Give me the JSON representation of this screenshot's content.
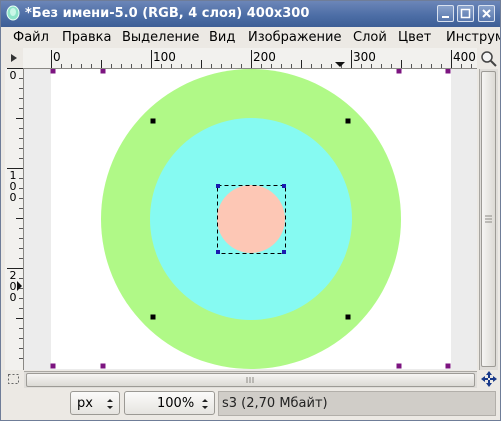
{
  "window": {
    "title": "*Без имени-5.0 (RGB, 4 слоя) 400x300"
  },
  "menu": {
    "items": [
      "Файл",
      "Правка",
      "Выделение",
      "Вид",
      "Изображение",
      "Слой",
      "Цвет",
      "Инструм"
    ]
  },
  "rulers": {
    "horizontal_labels": [
      "0",
      "100",
      "200",
      "300",
      "400"
    ],
    "vertical_labels": [
      "0",
      "100",
      "200"
    ]
  },
  "canvas": {
    "image_size": "400x300",
    "colors": {
      "outer_ring": "#b0f987",
      "middle_ring": "#86faf2",
      "inner_circle": "#fdc7b5",
      "background": "#ffffff",
      "handles": "#7c1480"
    }
  },
  "statusbar": {
    "unit": "px",
    "zoom": "100%",
    "message": "s3 (2,70 Мбайт)"
  }
}
